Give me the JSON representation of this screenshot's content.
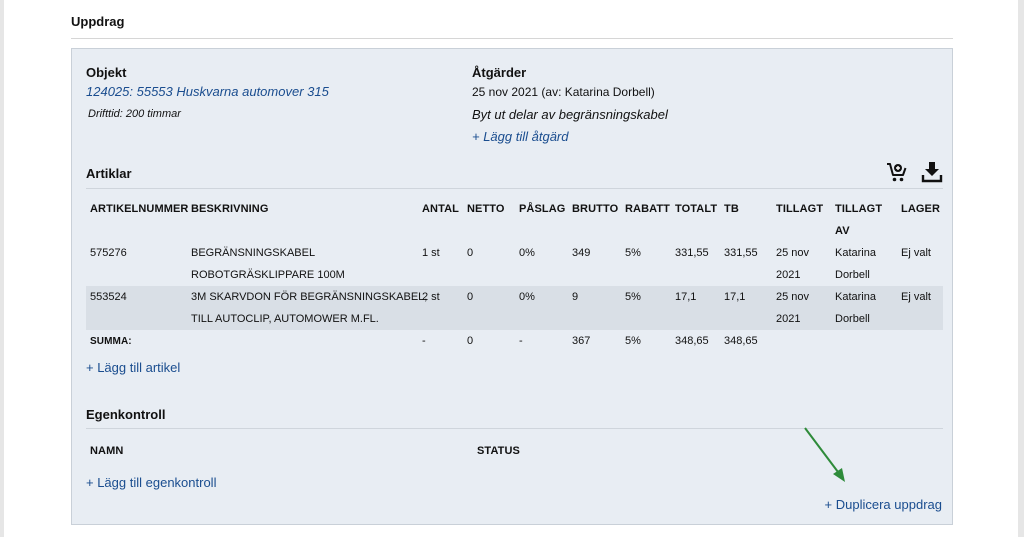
{
  "page": {
    "title": "Uppdrag"
  },
  "objekt": {
    "heading": "Objekt",
    "link": "124025: 55553 Huskvarna automover 315",
    "drifttid": "Drifttid: 200 timmar"
  },
  "atgarder": {
    "heading": "Åtgärder",
    "date_line": "25 nov 2021 (av: Katarina Dorbell)",
    "description": "Byt ut delar av begränsningskabel",
    "add_link": "+ Lägg till åtgärd"
  },
  "artiklar": {
    "heading": "Artiklar",
    "columns": {
      "artikelnummer": "ARTIKELNUMMER",
      "beskrivning": "BESKRIVNING",
      "antal": "ANTAL",
      "netto": "NETTO",
      "paslag": "PÅSLAG",
      "brutto": "BRUTTO",
      "rabatt": "RABATT",
      "totalt": "TOTALT",
      "tb": "TB",
      "tillagt": "TILLAGT",
      "tillagt_av_1": "TILLAGT",
      "tillagt_av_2": "AV",
      "lager": "LAGER"
    },
    "rows": [
      {
        "artikelnummer": "575276",
        "beskrivning_1": "BEGRÄNSNINGSKABEL",
        "beskrivning_2": "ROBOTGRÄSKLIPPARE 100M",
        "antal": "1 st",
        "netto": "0",
        "paslag": "0%",
        "brutto": "349",
        "rabatt": "5%",
        "totalt": "331,55",
        "tb": "331,55",
        "tillagt_1": "25 nov",
        "tillagt_2": "2021",
        "tillagt_av_1": "Katarina",
        "tillagt_av_2": "Dorbell",
        "lager": "Ej valt"
      },
      {
        "artikelnummer": "553524",
        "beskrivning_1": "3M SKARVDON FÖR BEGRÄNSNINGSKABEL,",
        "beskrivning_2": "TILL AUTOCLIP, AUTOMOWER M.FL.",
        "antal": "2 st",
        "netto": "0",
        "paslag": "0%",
        "brutto": "9",
        "rabatt": "5%",
        "totalt": "17,1",
        "tb": "17,1",
        "tillagt_1": "25 nov",
        "tillagt_2": "2021",
        "tillagt_av_1": "Katarina",
        "tillagt_av_2": "Dorbell",
        "lager": "Ej valt"
      }
    ],
    "summa": {
      "label": "SUMMA:",
      "antal": "-",
      "netto": "0",
      "paslag": "-",
      "brutto": "367",
      "rabatt": "5%",
      "totalt": "348,65",
      "tb": "348,65"
    },
    "add_link": "+ Lägg till artikel"
  },
  "egenkontroll": {
    "heading": "Egenkontroll",
    "col_namn": "NAMN",
    "col_status": "STATUS",
    "add_link": "+ Lägg till egenkontroll"
  },
  "duplicate_link": "+ Duplicera uppdrag",
  "icons": {
    "cart": "cart-add-icon",
    "download": "download-icon"
  },
  "colors": {
    "link": "#1a4d8f",
    "panel": "#e8edf3",
    "arrow": "#2e8b3a"
  }
}
